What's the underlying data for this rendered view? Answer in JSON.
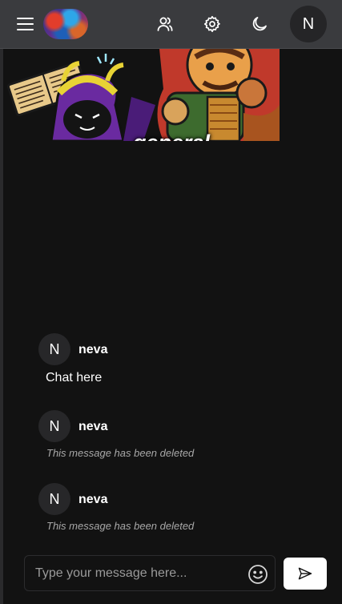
{
  "header": {
    "menu_icon": "hamburger-menu-icon",
    "logo": "app-logo",
    "users_icon": "users-icon",
    "settings_icon": "gear-icon",
    "theme_icon": "moon-icon",
    "avatar_initial": "N"
  },
  "channel": {
    "name": "general"
  },
  "messages": [
    {
      "avatar_initial": "N",
      "username": "neva",
      "text": "Chat here",
      "deleted": false
    },
    {
      "avatar_initial": "N",
      "username": "neva",
      "text": "This message has been deleted",
      "deleted": true
    },
    {
      "avatar_initial": "N",
      "username": "neva",
      "text": "This message has been deleted",
      "deleted": true
    }
  ],
  "composer": {
    "placeholder": "Type your message here...",
    "value": "",
    "emoji_icon": "smiley-icon",
    "send_icon": "send-icon"
  },
  "colors": {
    "background": "#121212",
    "topbar": "#3a3b3e",
    "deleted_text": "#a8a8a8",
    "send_button": "#ffffff"
  }
}
